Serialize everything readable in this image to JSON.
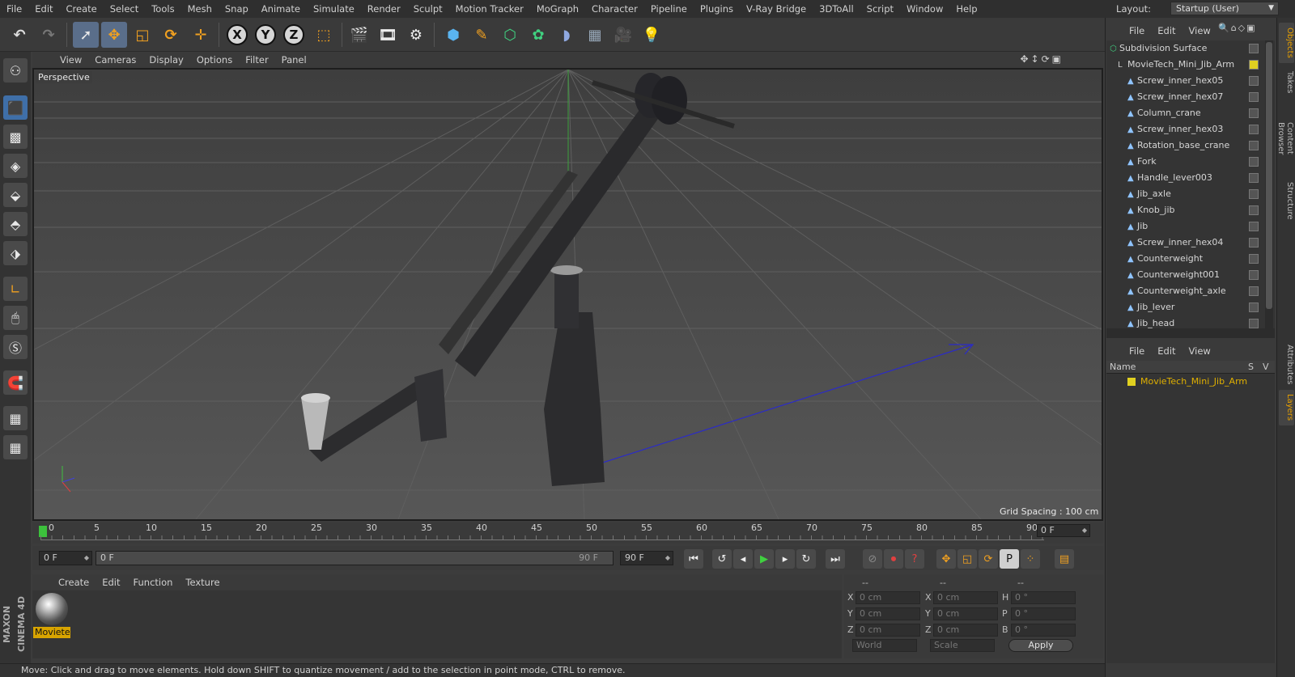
{
  "menubar": {
    "items": [
      "File",
      "Edit",
      "Create",
      "Select",
      "Tools",
      "Mesh",
      "Snap",
      "Animate",
      "Simulate",
      "Render",
      "Sculpt",
      "Motion Tracker",
      "MoGraph",
      "Character",
      "Pipeline",
      "Plugins",
      "V-Ray Bridge",
      "3DToAll",
      "Script",
      "Window",
      "Help"
    ],
    "layout_label": "Layout:",
    "layout_value": "Startup (User)"
  },
  "toolbar": {
    "icons": [
      "undo-icon",
      "redo-icon",
      "select-live-icon",
      "move-icon",
      "scale-icon",
      "rotate-icon",
      "move-axis-icon",
      "x-axis-lock",
      "y-axis-lock",
      "z-axis-lock",
      "coordinate-system-icon",
      "render-view-icon",
      "render-picture-viewer-icon",
      "render-settings-icon",
      "cube-primitive-icon",
      "pen-spline-icon",
      "subdivision-icon",
      "mograph-cloner-icon",
      "deformer-icon",
      "floor-environment-icon",
      "camera-icon",
      "light-icon"
    ],
    "axis_labels": [
      "X",
      "Y",
      "Z"
    ]
  },
  "viewport": {
    "menu": [
      "View",
      "Cameras",
      "Display",
      "Options",
      "Filter",
      "Panel"
    ],
    "label": "Perspective",
    "grid_spacing": "Grid Spacing : 100 cm"
  },
  "timeline": {
    "ticks": [
      "0",
      "5",
      "10",
      "15",
      "20",
      "25",
      "30",
      "35",
      "40",
      "45",
      "50",
      "55",
      "60",
      "65",
      "70",
      "75",
      "80",
      "85",
      "90"
    ],
    "current_frame": "0 F"
  },
  "transport": {
    "start_field": "0 F",
    "range_start": "0 F",
    "range_end": "90 F",
    "end_field": "90 F"
  },
  "material_manager": {
    "menu": [
      "Create",
      "Edit",
      "Function",
      "Texture"
    ],
    "material_name": "Moviete"
  },
  "coordinates": {
    "header": [
      "--",
      "--",
      "--"
    ],
    "rows": [
      {
        "a": "X",
        "av": "0 cm",
        "b": "X",
        "bv": "0 cm",
        "c": "H",
        "cv": "0 °"
      },
      {
        "a": "Y",
        "av": "0 cm",
        "b": "Y",
        "bv": "0 cm",
        "c": "P",
        "cv": "0 °"
      },
      {
        "a": "Z",
        "av": "0 cm",
        "b": "Z",
        "bv": "0 cm",
        "c": "B",
        "cv": "0 °"
      }
    ],
    "space": "World",
    "mode": "Scale",
    "apply": "Apply"
  },
  "objects": {
    "menu": [
      "File",
      "Edit",
      "View"
    ],
    "items": [
      "Subdivision Surface",
      "MovieTech_Mini_Jib_Arm",
      "Screw_inner_hex05",
      "Screw_inner_hex07",
      "Column_crane",
      "Screw_inner_hex03",
      "Rotation_base_crane",
      "Fork",
      "Handle_lever003",
      "Jib_axle",
      "Knob_jib",
      "Jib",
      "Screw_inner_hex04",
      "Counterweight",
      "Counterweight001",
      "Counterweight_axle",
      "Jib_lever",
      "Jib_head"
    ]
  },
  "layers": {
    "menu": [
      "File",
      "Edit",
      "View"
    ],
    "col_name": "Name",
    "col_s": "S",
    "col_v": "V",
    "row": "MovieTech_Mini_Jib_Arm",
    "row_color": "#e0d020"
  },
  "right_tabs": [
    "Objects",
    "Takes",
    "Content Browser",
    "Structure",
    "Attributes",
    "Layers"
  ],
  "status": "Move: Click and drag to move elements. Hold down SHIFT to quantize movement / add to the selection in point mode, CTRL to remove.",
  "brand": "MAXON CINEMA 4D",
  "colors": {
    "accent": "#5a6e8a",
    "selection": "#d8a400",
    "layer": "#e0d020"
  }
}
